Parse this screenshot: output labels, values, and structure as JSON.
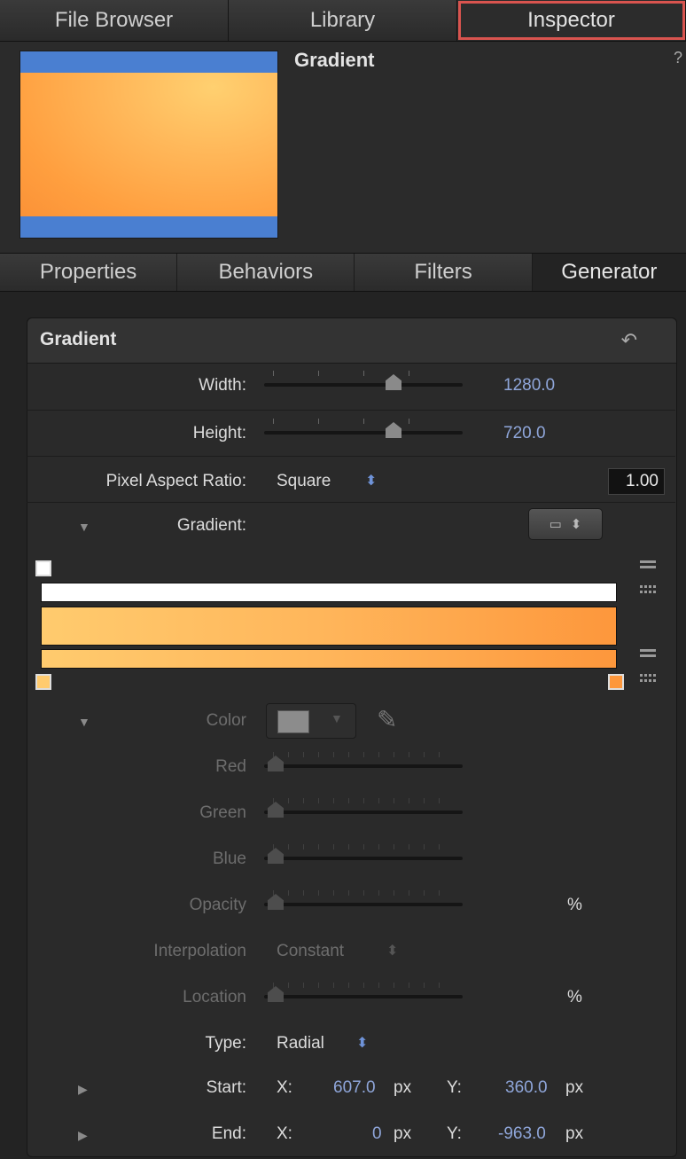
{
  "top_tabs": [
    "File Browser",
    "Library",
    "Inspector"
  ],
  "preview": {
    "title": "Gradient"
  },
  "sub_tabs": [
    "Properties",
    "Behaviors",
    "Filters",
    "Generator"
  ],
  "panel": {
    "title": "Gradient",
    "width": {
      "label": "Width:",
      "value": "1280.0"
    },
    "height": {
      "label": "Height:",
      "value": "720.0"
    },
    "pixel_aspect": {
      "label": "Pixel Aspect Ratio:",
      "value": "Square",
      "ratio": "1.00"
    },
    "gradient": {
      "label": "Gradient:"
    },
    "color": {
      "label": "Color"
    },
    "red": {
      "label": "Red"
    },
    "green": {
      "label": "Green"
    },
    "blue": {
      "label": "Blue"
    },
    "opacity": {
      "label": "Opacity",
      "unit": "%"
    },
    "interpolation": {
      "label": "Interpolation",
      "value": "Constant"
    },
    "location": {
      "label": "Location",
      "unit": "%"
    },
    "type": {
      "label": "Type:",
      "value": "Radial"
    },
    "start": {
      "label": "Start:",
      "x_label": "X:",
      "x_value": "607.0",
      "x_unit": "px",
      "y_label": "Y:",
      "y_value": "360.0",
      "y_unit": "px"
    },
    "end": {
      "label": "End:",
      "x_label": "X:",
      "x_value": "0",
      "x_unit": "px",
      "y_label": "Y:",
      "y_value": "-963.0",
      "y_unit": "px"
    }
  },
  "colors": {
    "gradient_start": "#ffcb6e",
    "gradient_end": "#fd973c",
    "accent": "#8fa6da",
    "highlight_outline": "#d9544f"
  },
  "icons": [
    "help-icon",
    "reset-icon",
    "disclosure-triangle-icon",
    "eyedropper-icon",
    "stepper-icon",
    "preset-icon",
    "duplicate-bars-icon"
  ]
}
